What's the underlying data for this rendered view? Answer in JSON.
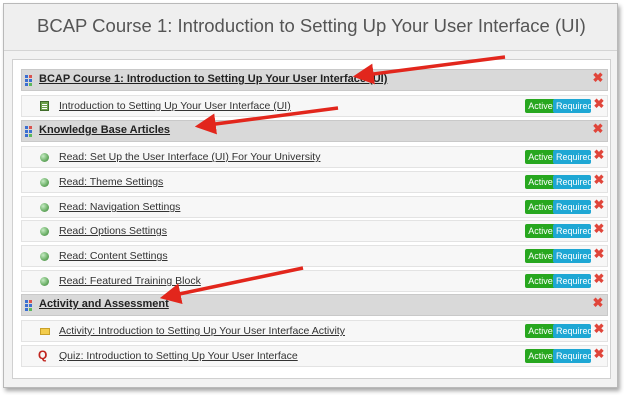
{
  "page_title": "BCAP Course 1: Introduction to Setting Up Your User Interface (UI)",
  "badges": {
    "active": "Active",
    "required": "Required"
  },
  "remove_glyph": "✖",
  "colors": {
    "active_badge": "#27a71f",
    "required_badge": "#1ea7d4",
    "remove_icon": "#e0453a",
    "annotation_arrow": "#e2261c"
  },
  "sections": [
    {
      "title": "BCAP Course 1: Introduction to Setting Up Your User Interface (UI)",
      "icon": "module-grid-icon",
      "items": [
        {
          "label": "Introduction to Setting Up Your User Interface (UI)",
          "icon": "document-icon"
        }
      ]
    },
    {
      "title": "Knowledge Base Articles",
      "icon": "module-grid-icon",
      "items": [
        {
          "label": "Read: Set Up the User Interface (UI) For Your University",
          "icon": "green-dot-icon"
        },
        {
          "label": "Read: Theme Settings",
          "icon": "green-dot-icon"
        },
        {
          "label": "Read: Navigation Settings",
          "icon": "green-dot-icon"
        },
        {
          "label": "Read: Options Settings",
          "icon": "green-dot-icon"
        },
        {
          "label": "Read: Content Settings",
          "icon": "green-dot-icon"
        },
        {
          "label": "Read: Featured Training Block",
          "icon": "green-dot-icon"
        }
      ]
    },
    {
      "title": "Activity and Assessment",
      "icon": "module-grid-icon",
      "items": [
        {
          "label": "Activity: Introduction to Setting Up Your User Interface Activity",
          "icon": "folder-icon"
        },
        {
          "label": "Quiz: Introduction to Setting Up Your User Interface",
          "icon": "quiz-icon",
          "glyph": "Q"
        }
      ]
    }
  ]
}
